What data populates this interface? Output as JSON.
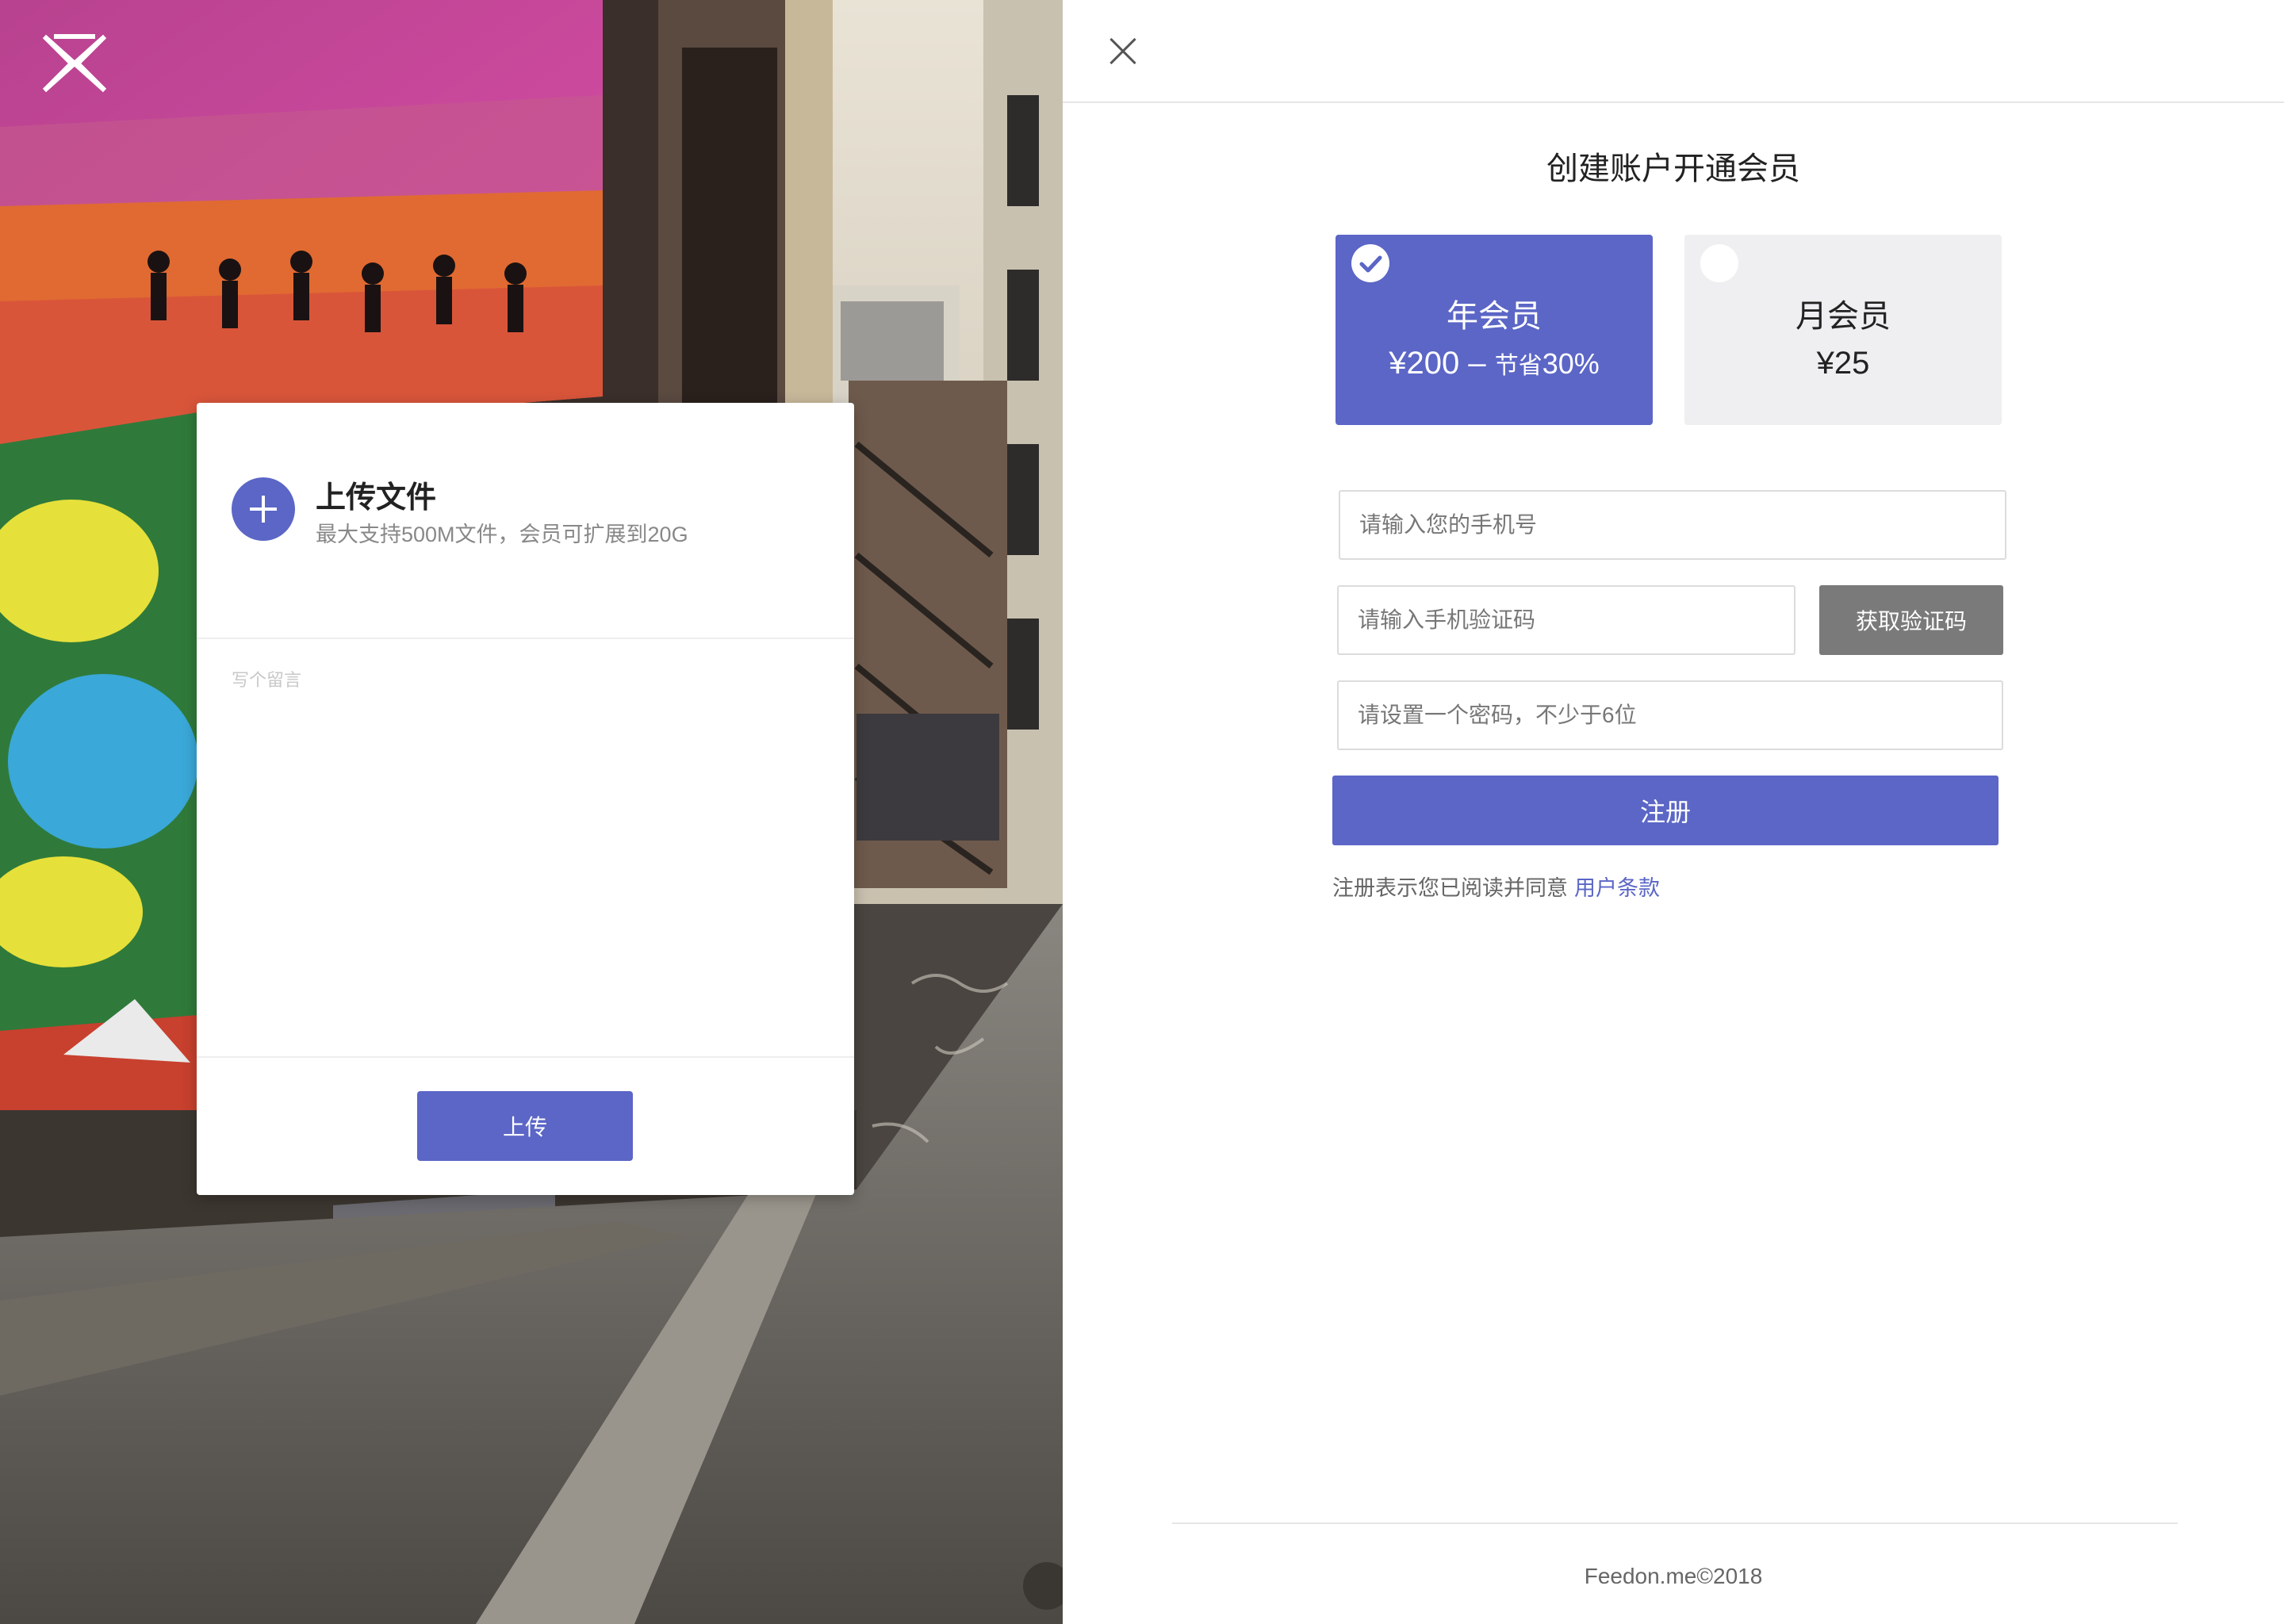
{
  "upload": {
    "title": "上传文件",
    "subtitle": "最大支持500M文件，会员可扩展到20G",
    "message_placeholder": "写个留言",
    "upload_label": "上传"
  },
  "signup": {
    "title": "创建账户开通会员",
    "plans": [
      {
        "name": "年会员",
        "price": "¥200",
        "dash": "–",
        "save_text": "节省",
        "save_pct": "30%",
        "selected": true
      },
      {
        "name": "月会员",
        "price": "¥25",
        "selected": false
      }
    ],
    "phone_placeholder": "请输入您的手机号",
    "code_placeholder": "请输入手机验证码",
    "get_code_label": "获取验证码",
    "password_placeholder": "请设置一个密码，不少于6位",
    "register_label": "注册",
    "agree_text": "注册表示您已阅读并同意",
    "terms_link": "用户条款"
  },
  "footer": {
    "text": "Feedon.me©2018"
  },
  "colors": {
    "accent": "#5b66c6",
    "code_button": "#7a7a7a",
    "plan_unselected": "#efeff2"
  }
}
